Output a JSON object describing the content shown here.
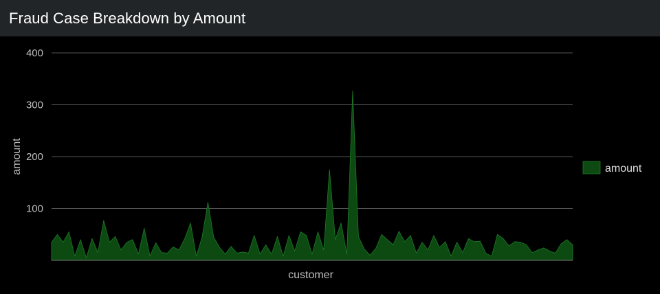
{
  "panel": {
    "title": "Fraud Case Breakdown by Amount"
  },
  "colors": {
    "background": "#000000",
    "header": "#212527",
    "gridline": "#555555",
    "series_fill": "#0c4a12",
    "series_stroke": "#1e7a28"
  },
  "chart_data": {
    "type": "area",
    "title": "",
    "xlabel": "customer",
    "ylabel": "amount",
    "ylim": [
      0,
      400
    ],
    "yticks": [
      100,
      200,
      300,
      400
    ],
    "grid": true,
    "legend_position": "right",
    "series": [
      {
        "name": "amount",
        "values": [
          35,
          50,
          35,
          55,
          8,
          40,
          5,
          42,
          15,
          77,
          35,
          46,
          20,
          35,
          40,
          12,
          62,
          8,
          34,
          15,
          14,
          26,
          20,
          42,
          72,
          8,
          45,
          112,
          45,
          25,
          12,
          27,
          14,
          16,
          14,
          48,
          12,
          30,
          12,
          46,
          8,
          48,
          18,
          55,
          48,
          12,
          55,
          20,
          175,
          40,
          72,
          12,
          327,
          46,
          22,
          10,
          23,
          50,
          40,
          30,
          56,
          36,
          48,
          14,
          35,
          20,
          48,
          25,
          36,
          8,
          35,
          15,
          42,
          36,
          37,
          14,
          8,
          50,
          42,
          28,
          36,
          35,
          30,
          15,
          20,
          24,
          18,
          14,
          32,
          40,
          30
        ]
      }
    ]
  }
}
